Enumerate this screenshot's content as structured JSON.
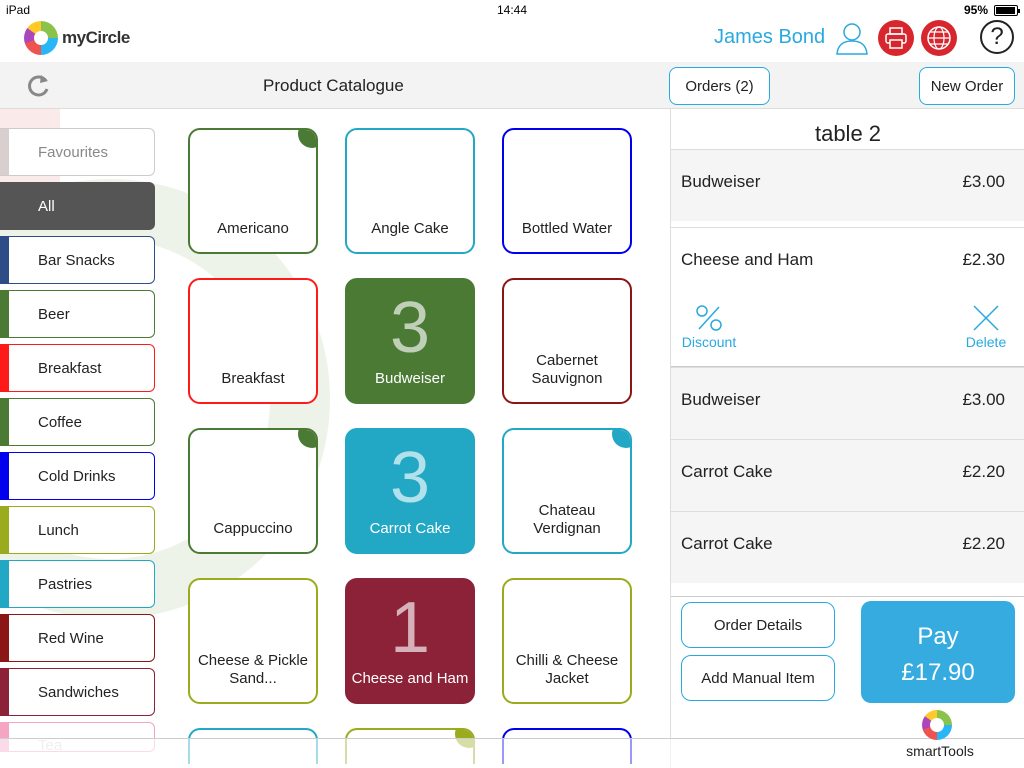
{
  "status": {
    "device": "iPad",
    "time": "14:44",
    "battery": "95%"
  },
  "header": {
    "app_name": "myCircle",
    "user_name": "James Bond"
  },
  "toolbar": {
    "title": "Product Catalogue",
    "orders_label": "Orders (2)",
    "new_order_label": "New Order"
  },
  "categories": [
    {
      "label": "Favourites",
      "color": "#d9cfcf"
    },
    {
      "label": "All",
      "color": "#555555"
    },
    {
      "label": "Bar Snacks",
      "color": "#2e4d86"
    },
    {
      "label": "Beer",
      "color": "#4a7a34"
    },
    {
      "label": "Breakfast",
      "color": "#ff1a1a"
    },
    {
      "label": "Coffee",
      "color": "#4a7a34"
    },
    {
      "label": "Cold Drinks",
      "color": "#0000ee"
    },
    {
      "label": "Lunch",
      "color": "#9aab1e"
    },
    {
      "label": "Pastries",
      "color": "#22a8c4"
    },
    {
      "label": "Red Wine",
      "color": "#8b1616"
    },
    {
      "label": "Sandwiches",
      "color": "#8b2238"
    },
    {
      "label": "Tea",
      "color": "#f06b9a"
    }
  ],
  "products": [
    {
      "name": "Americano",
      "color": "#4a7a34",
      "qty": "",
      "corner": true,
      "filled": false
    },
    {
      "name": "Angle Cake",
      "color": "#22a8c4",
      "qty": "",
      "corner": false,
      "filled": false
    },
    {
      "name": "Bottled Water",
      "color": "#0000ee",
      "qty": "",
      "corner": false,
      "filled": false
    },
    {
      "name": "Breakfast",
      "color": "#ff1a1a",
      "qty": "",
      "corner": false,
      "filled": false
    },
    {
      "name": "Budweiser",
      "color": "#4a7a34",
      "qty": "3",
      "corner": false,
      "filled": true
    },
    {
      "name": "Cabernet Sauvignon",
      "color": "#8b1616",
      "qty": "",
      "corner": false,
      "filled": false
    },
    {
      "name": "Cappuccino",
      "color": "#4a7a34",
      "qty": "",
      "corner": true,
      "filled": false
    },
    {
      "name": "Carrot Cake",
      "color": "#22a8c4",
      "qty": "3",
      "corner": false,
      "filled": true
    },
    {
      "name": "Chateau Verdignan",
      "color": "#22a8c4",
      "qty": "",
      "corner": true,
      "filled": false
    },
    {
      "name": "Cheese & Pickle Sand...",
      "color": "#9aab1e",
      "qty": "",
      "corner": false,
      "filled": false
    },
    {
      "name": "Cheese and Ham",
      "color": "#8b2238",
      "qty": "1",
      "corner": false,
      "filled": true
    },
    {
      "name": "Chilli & Cheese Jacket",
      "color": "#9aab1e",
      "qty": "",
      "corner": false,
      "filled": false
    },
    {
      "name": "",
      "color": "#22a8c4",
      "qty": "",
      "corner": false,
      "filled": false
    },
    {
      "name": "",
      "color": "#9aab1e",
      "qty": "",
      "corner": true,
      "filled": false
    },
    {
      "name": "",
      "color": "#0000ee",
      "qty": "",
      "corner": false,
      "filled": false
    }
  ],
  "order": {
    "table": "table 2",
    "lines": [
      {
        "name": "Budweiser",
        "price": "£3.00"
      },
      {
        "name": "Cheese and Ham",
        "price": "£2.30"
      },
      {
        "name": "Budweiser",
        "price": "£3.00"
      },
      {
        "name": "Carrot Cake",
        "price": "£2.20"
      },
      {
        "name": "Carrot Cake",
        "price": "£2.20"
      }
    ],
    "discount_label": "Discount",
    "delete_label": "Delete",
    "details_label": "Order Details",
    "manual_label": "Add Manual Item",
    "pay_label": "Pay",
    "total": "£17.90"
  },
  "footer": {
    "brand": "smartTools"
  },
  "icons": {
    "logo": "mycircle-logo-icon",
    "user": "user-icon",
    "printer": "printer-icon",
    "globe": "globe-icon",
    "help": "help-icon",
    "refresh": "refresh-icon",
    "discount": "percent-icon",
    "delete": "close-icon"
  },
  "colors": {
    "accent": "#29a9e0",
    "red": "#d8262e",
    "pay": "#35abe0"
  }
}
